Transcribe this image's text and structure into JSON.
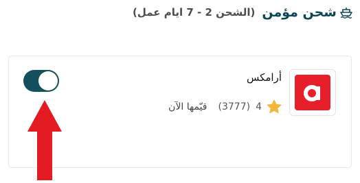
{
  "section": {
    "title": "شحن مؤمن",
    "subtitle": "(الشحن 2 - 7 ايام عمل)",
    "icon": "shipping-boat-icon"
  },
  "option": {
    "name": "أرامكس",
    "rating": "4",
    "reviews": "(3777)",
    "rate_link": "قيّمها الآن",
    "logo_icon": "aramex-logo",
    "selected": true
  },
  "annotation": {
    "icon": "arrow-up-icon",
    "color": "#e51b23"
  },
  "colors": {
    "accent": "#134f5c",
    "brand": "#e61f2a",
    "star": "#f4b63b"
  }
}
